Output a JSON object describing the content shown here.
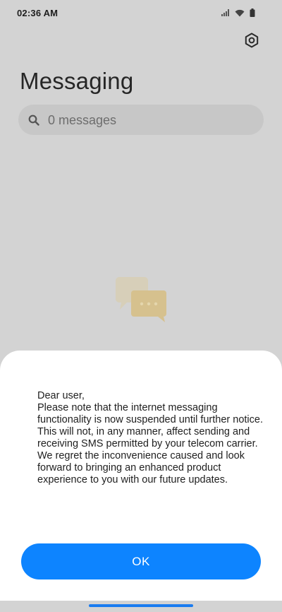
{
  "status_bar": {
    "time": "02:36 AM",
    "icons": [
      "signal-icon",
      "wifi-icon",
      "battery-icon"
    ]
  },
  "header": {
    "settings_icon": "gear-icon",
    "title": "Messaging"
  },
  "search": {
    "icon": "search-icon",
    "placeholder": "0 messages"
  },
  "empty_state": {
    "illustration": "chat-bubbles-icon"
  },
  "dialog": {
    "message": "Dear user,\nPlease note that the internet messaging functionality is now suspended until further notice. This will not, in any manner, affect sending and receiving SMS permitted by your telecom carrier. We regret the inconvenience caused and look forward to bringing an enhanced product experience to you with our future updates.",
    "ok_label": "OK"
  },
  "colors": {
    "accent": "#0d84ff",
    "dim_background": "#d3d3d3",
    "sheet_background": "#ffffff"
  }
}
